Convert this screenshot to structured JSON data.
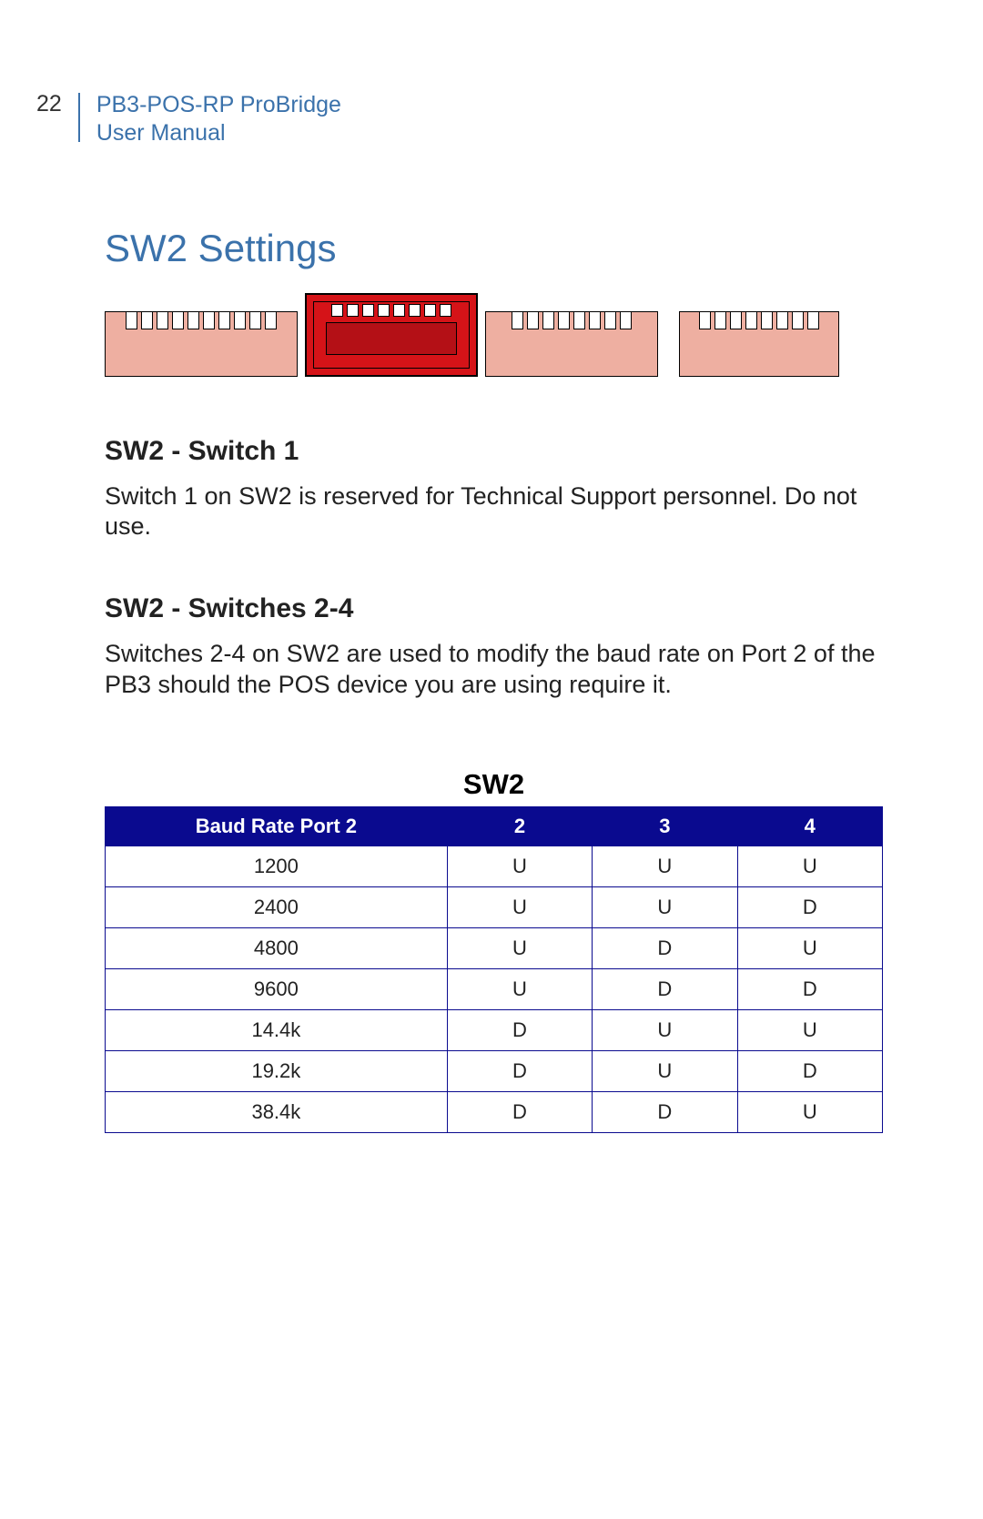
{
  "header": {
    "page_number": "22",
    "doc_title_line1": "PB3-POS-RP ProBridge",
    "doc_title_line2": "User Manual"
  },
  "title": "SW2 Settings",
  "section1": {
    "heading": "SW2 - Switch 1",
    "body": "Switch 1 on SW2 is reserved for Technical Support personnel. Do not use."
  },
  "section2": {
    "heading": "SW2 - Switches 2-4",
    "body": "Switches 2-4 on SW2 are used to modify the baud rate on Port 2 of the PB3 should the POS device you are using require it."
  },
  "table": {
    "title": "SW2",
    "headers": [
      "Baud Rate Port 2",
      "2",
      "3",
      "4"
    ],
    "rows": [
      [
        "1200",
        "U",
        "U",
        "U"
      ],
      [
        "2400",
        "U",
        "U",
        "D"
      ],
      [
        "4800",
        "U",
        "D",
        "U"
      ],
      [
        "9600",
        "U",
        "D",
        "D"
      ],
      [
        "14.4k",
        "D",
        "U",
        "U"
      ],
      [
        "19.2k",
        "D",
        "U",
        "D"
      ],
      [
        "38.4k",
        "D",
        "D",
        "U"
      ]
    ]
  }
}
